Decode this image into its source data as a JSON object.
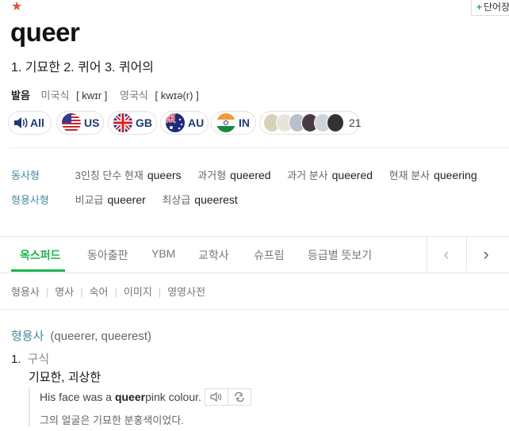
{
  "star_icon": "star-icon",
  "add_word": {
    "plus": "+",
    "label": "단어장"
  },
  "headword": "queer",
  "meanings": "1. 기묘한 2. 퀴어 3. 퀴어의",
  "pronunciation": {
    "label": "발음",
    "us_label": "미국식",
    "us_ipa": "[ kwɪr ]",
    "uk_label": "영국식",
    "uk_ipa": "[ kwɪə(r) ]"
  },
  "audio": {
    "all": "All",
    "us": "US",
    "gb": "GB",
    "au": "AU",
    "in": "IN",
    "user_count": "21"
  },
  "verb_forms": {
    "type": "동사형",
    "items": [
      {
        "label": "3인칭 단수 현재",
        "word": "queers"
      },
      {
        "label": "과거형",
        "word": "queered"
      },
      {
        "label": "과거 분사",
        "word": "queered"
      },
      {
        "label": "현재 분사",
        "word": "queering"
      }
    ]
  },
  "adj_forms": {
    "type": "형용사형",
    "items": [
      {
        "label": "비교급",
        "word": "queerer"
      },
      {
        "label": "최상급",
        "word": "queerest"
      }
    ]
  },
  "tabs": [
    "옥스퍼드",
    "동아출판",
    "YBM",
    "교학사",
    "슈프림",
    "등급별 뜻보기"
  ],
  "subtabs": [
    "형용사",
    "명사",
    "숙어",
    "이미지",
    "영영사전"
  ],
  "entry": {
    "pos": "형용사",
    "forms": "(queerer, queerest)",
    "sense_num": "1.",
    "sense_tag": "구식",
    "gloss": "기묘한, 괴상한",
    "example_pre": "His face was a ",
    "example_bold": "queer",
    "example_post": " pink colour.",
    "example_ko": "그의 얼굴은 기묘한 분홍색이었다."
  },
  "colors": {
    "accent": "#19b34d",
    "star": "#e0563b",
    "label_teal": "#4a8a9e"
  }
}
